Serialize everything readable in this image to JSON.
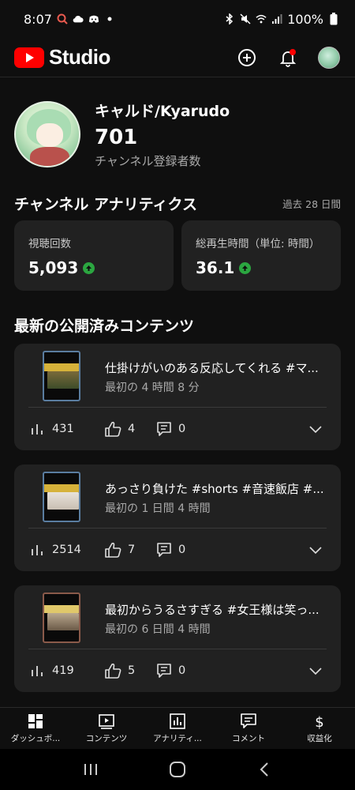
{
  "status_bar": {
    "time": "8:07",
    "battery": "100%",
    "left_icons": [
      "search-app-icon",
      "cloud-icon",
      "discord-icon",
      "dot-icon"
    ],
    "right_icons": [
      "bluetooth-icon",
      "mute-icon",
      "wifi-icon",
      "signal-icon",
      "battery-icon"
    ]
  },
  "app_header": {
    "logo_text": "Studio",
    "brand_color": "#ff0000",
    "actions": [
      "create-icon",
      "notifications-icon",
      "account-avatar"
    ]
  },
  "channel": {
    "name": "キャルド/Kyarudo",
    "subscribers": "701",
    "subscribers_label": "チャンネル登録者数"
  },
  "analytics": {
    "title": "チャンネル アナリティクス",
    "period": "過去 28 日間",
    "metrics": [
      {
        "label": "視聴回数",
        "value": "5,093",
        "trend": "up"
      },
      {
        "label": "総再生時間（単位: 時間）",
        "value": "36.1",
        "trend": "up"
      }
    ],
    "trend_color": "#2ba640"
  },
  "latest": {
    "title": "最新の公開済みコンテンツ",
    "videos": [
      {
        "title": "仕掛けがいのある反応してくれる #マ...",
        "subtitle": "最初の 4 時間 8 分",
        "views": "431",
        "likes": "4",
        "comments": "0"
      },
      {
        "title": "あっさり負けた #shorts #音速飯店 #...",
        "subtitle": "最初の 1 日間 4 時間",
        "views": "2514",
        "likes": "7",
        "comments": "0"
      },
      {
        "title": "最初からうるさすぎる #女王様は笑っ...",
        "subtitle": "最初の 6 日間 4 時間",
        "views": "419",
        "likes": "5",
        "comments": "0"
      }
    ]
  },
  "bottom_nav": {
    "items": [
      {
        "label": "ダッシュボ...",
        "icon": "dashboard-icon"
      },
      {
        "label": "コンテンツ",
        "icon": "content-icon"
      },
      {
        "label": "アナリティ...",
        "icon": "analytics-icon"
      },
      {
        "label": "コメント",
        "icon": "comments-icon"
      },
      {
        "label": "収益化",
        "icon": "monetization-icon"
      }
    ]
  },
  "system_nav": [
    "recents-icon",
    "home-icon",
    "back-icon"
  ]
}
